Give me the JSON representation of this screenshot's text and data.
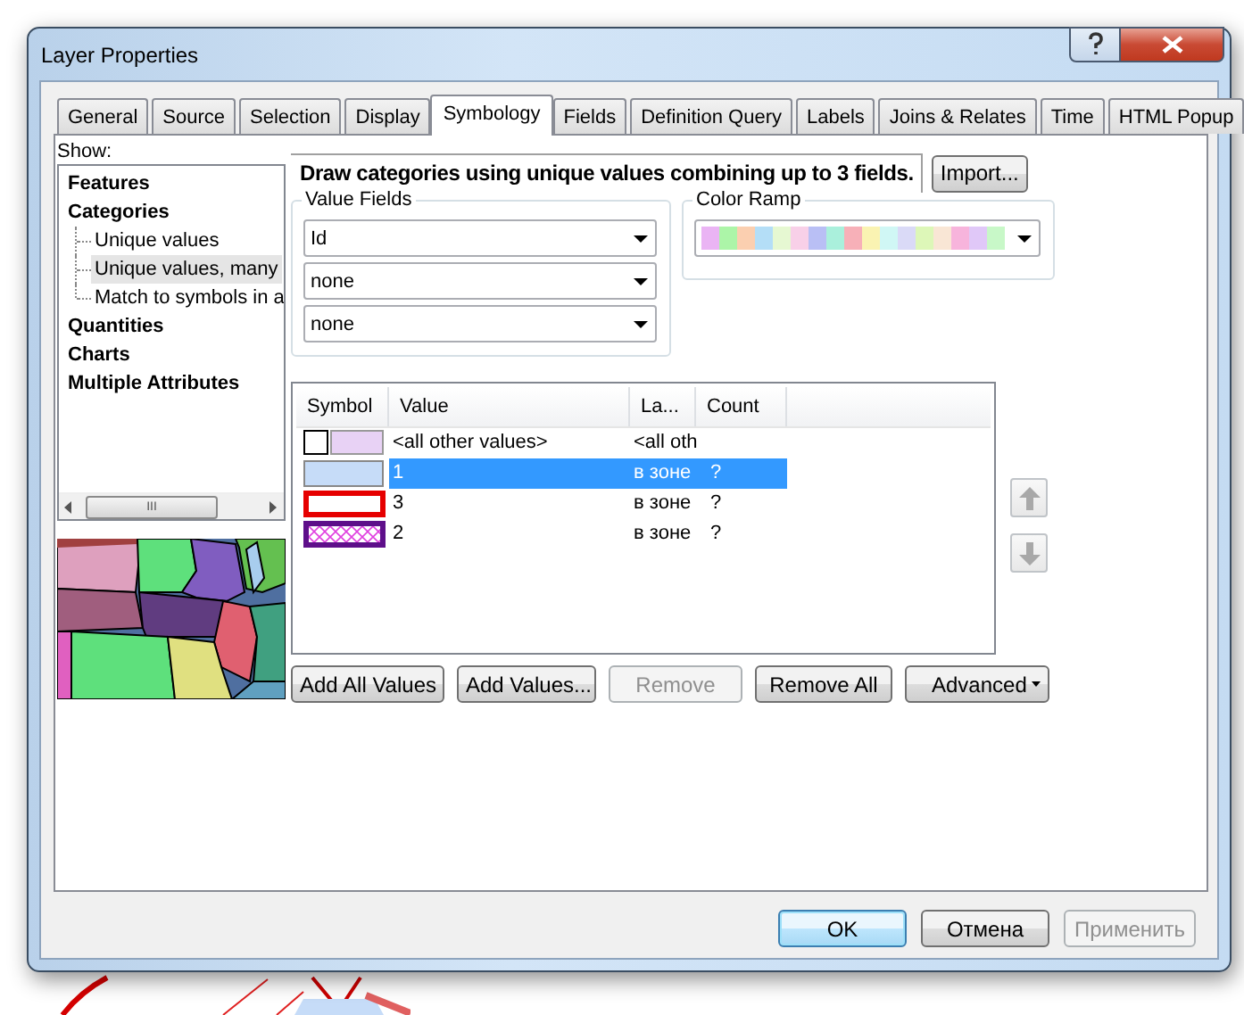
{
  "window": {
    "title": "Layer Properties"
  },
  "tabs": [
    {
      "label": "General",
      "selected": false
    },
    {
      "label": "Source",
      "selected": false
    },
    {
      "label": "Selection",
      "selected": false
    },
    {
      "label": "Display",
      "selected": false
    },
    {
      "label": "Symbology",
      "selected": true
    },
    {
      "label": "Fields",
      "selected": false
    },
    {
      "label": "Definition Query",
      "selected": false
    },
    {
      "label": "Labels",
      "selected": false
    },
    {
      "label": "Joins & Relates",
      "selected": false
    },
    {
      "label": "Time",
      "selected": false
    },
    {
      "label": "HTML Popup",
      "selected": false
    }
  ],
  "show": {
    "label": "Show:",
    "items": [
      {
        "label": "Features",
        "selected": false
      },
      {
        "label": "Categories",
        "selected": false,
        "children": [
          {
            "label": "Unique values",
            "selected": false
          },
          {
            "label": "Unique values, many",
            "selected": true
          },
          {
            "label": "Match to symbols in a",
            "selected": false
          }
        ]
      },
      {
        "label": "Quantities",
        "selected": false
      },
      {
        "label": "Charts",
        "selected": false
      },
      {
        "label": "Multiple Attributes",
        "selected": false
      }
    ],
    "scroll_thumb": "III"
  },
  "description": "Draw categories using unique values combining up to 3 fields.",
  "import_button": "Import...",
  "value_fields": {
    "label": "Value Fields",
    "fields": [
      "Id",
      "none",
      "none"
    ]
  },
  "color_ramp": {
    "label": "Color Ramp",
    "swatches": [
      {
        "color": "#eab4f4"
      },
      {
        "color": "#acf5a8"
      },
      {
        "color": "#fbcfb0"
      },
      {
        "color": "#b4def7"
      },
      {
        "color": "#e6f8d2"
      },
      {
        "color": "#f8d0e8"
      },
      {
        "color": "#b9bff5"
      },
      {
        "color": "#aaf0dc"
      },
      {
        "color": "#f7b0b8"
      },
      {
        "color": "#faf3b2"
      },
      {
        "color": "#d0f7f5"
      },
      {
        "color": "#dadaf7"
      },
      {
        "color": "#ddf7b8"
      },
      {
        "color": "#f9e6d5"
      },
      {
        "color": "#f7b4dc"
      },
      {
        "color": "#e0c8f8"
      },
      {
        "color": "#c8f8c8"
      }
    ]
  },
  "table": {
    "columns": [
      "Symbol",
      "Value",
      "La...",
      "Count"
    ],
    "rows": [
      {
        "symbol": {
          "kind": "default",
          "color": "#e8d2f5"
        },
        "value": "<all other values>",
        "label": "<all oth",
        "selected": false
      },
      {
        "symbol": {
          "kind": "fill",
          "color": "#c6dcf8"
        },
        "value": "1",
        "label": "в зоне",
        "count": "?",
        "selected": true
      },
      {
        "symbol": {
          "kind": "outline",
          "color": "#e60000"
        },
        "value": "3",
        "label": "в зоне",
        "count": "?",
        "selected": false
      },
      {
        "symbol": {
          "kind": "hatch",
          "color": "#5e0f8a"
        },
        "value": "2",
        "label": "в зоне",
        "count": "?",
        "selected": false
      }
    ]
  },
  "actions": [
    {
      "label": "Add All Values",
      "kind": "button",
      "disabled": false
    },
    {
      "label": "Add Values...",
      "kind": "button",
      "disabled": false
    },
    {
      "label": "Remove",
      "kind": "button",
      "disabled": true
    },
    {
      "label": "Remove All",
      "kind": "button",
      "disabled": false
    },
    {
      "label": "Advanced",
      "kind": "menu",
      "disabled": false
    }
  ],
  "dialog_buttons": [
    {
      "label": "OK",
      "default": true,
      "disabled": false
    },
    {
      "label": "Отмена",
      "default": false,
      "disabled": false
    },
    {
      "label": "Применить",
      "default": false,
      "disabled": true
    }
  ]
}
